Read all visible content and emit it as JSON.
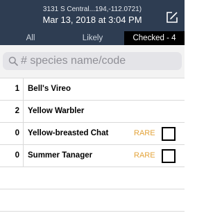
{
  "header": {
    "location": "3131 S Central...194,-112.0721)",
    "datetime": "Mar 13, 2018 at 3:04 PM",
    "edit_icon": "edit-icon"
  },
  "tabs": [
    {
      "label": "All",
      "selected": false
    },
    {
      "label": "Likely",
      "selected": false
    },
    {
      "label": "Checked - 4",
      "selected": true
    }
  ],
  "search": {
    "placeholder": "# species name/code",
    "value": "",
    "icon": "search-icon"
  },
  "species": [
    {
      "count": "1",
      "name": "Bell's Vireo",
      "rare": "",
      "checkbox": false
    },
    {
      "count": "2",
      "name": "Yellow Warbler",
      "rare": "",
      "checkbox": false
    },
    {
      "count": "0",
      "name": "Yellow-breasted Chat",
      "rare": "RARE",
      "checkbox": true
    },
    {
      "count": "0",
      "name": "Summer Tanager",
      "rare": "RARE",
      "checkbox": true
    }
  ],
  "colors": {
    "header_bg": "#2e3d52",
    "selected_tab_bg": "#000000",
    "rare": "#e3a33a"
  }
}
